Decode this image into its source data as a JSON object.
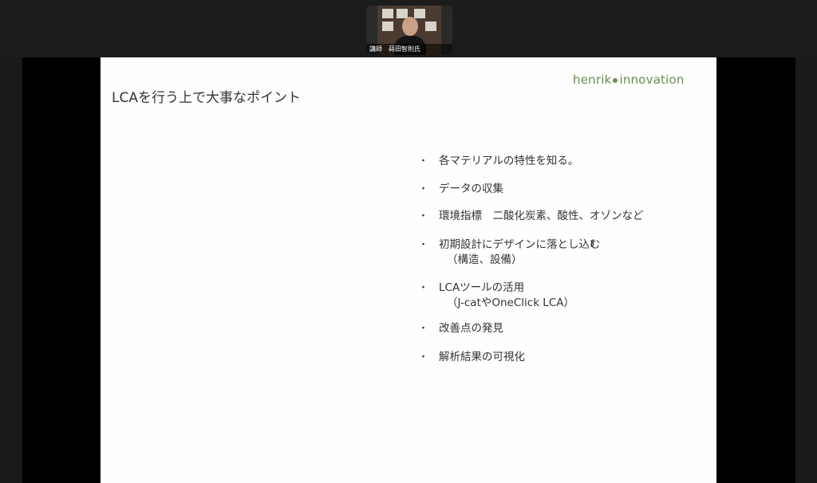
{
  "meeting": {
    "speaker_label": "講師　蒔田智則氏"
  },
  "slide": {
    "title": "LCAを行う上で大事なポイント",
    "logo_left": "henrik",
    "logo_right": "innovation",
    "bullet_symbol": "・",
    "bullets": [
      {
        "text": "各マテリアルの特性を知る。",
        "sub": ""
      },
      {
        "text": "データの収集",
        "sub": ""
      },
      {
        "text": "環境指標　二酸化炭素、酸性、オゾンなど",
        "sub": ""
      },
      {
        "text": "初期設計にデザインに落とし込む",
        "sub": "（構造、設備）"
      },
      {
        "text": "LCAツールの活用",
        "sub": "（J-catやOneClick LCA）"
      },
      {
        "text": "改善点の発見",
        "sub": ""
      },
      {
        "text": "解析結果の可視化",
        "sub": ""
      }
    ]
  },
  "colors": {
    "logo": "#6f8a52",
    "slide_bg": "#fefefe",
    "frame_bg": "#1a1a1a"
  }
}
